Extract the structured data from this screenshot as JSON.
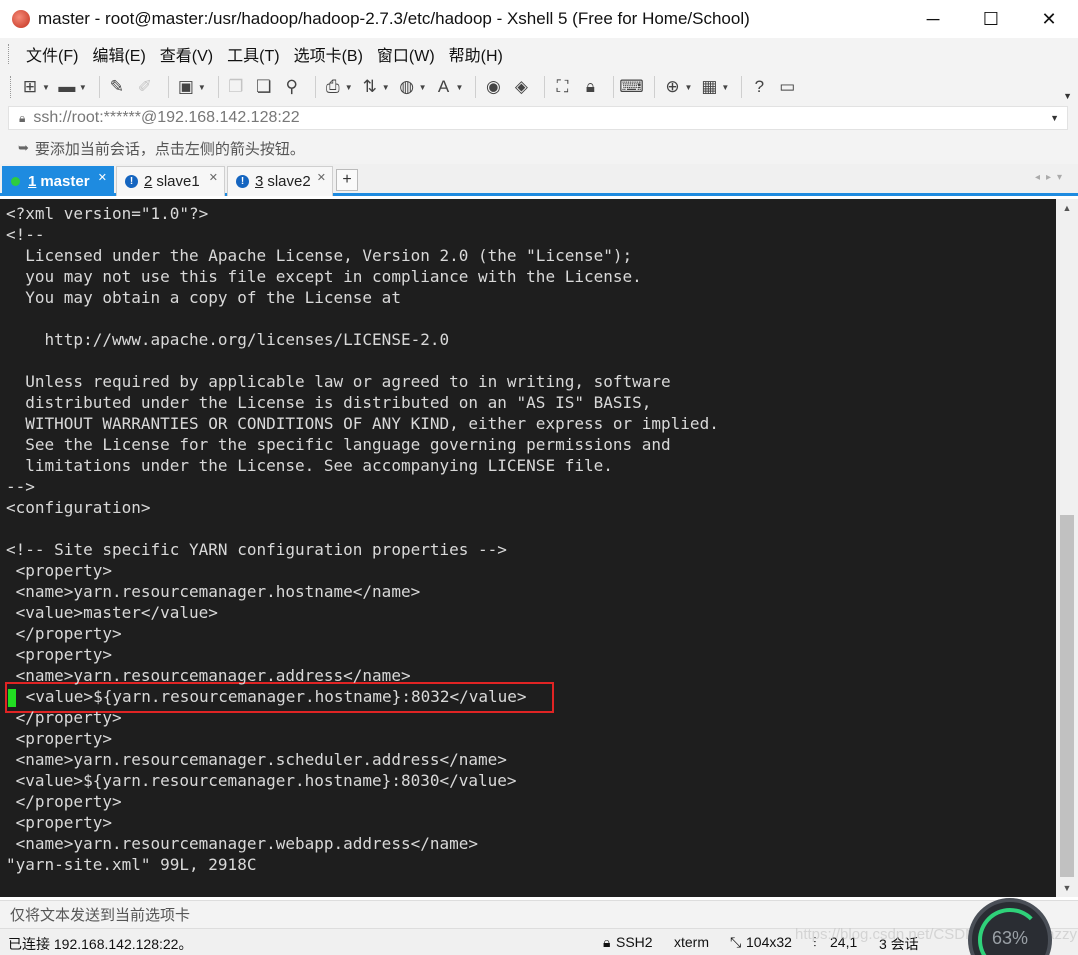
{
  "window": {
    "title": "master - root@master:/usr/hadoop/hadoop-2.7.3/etc/hadoop - Xshell 5 (Free for Home/School)",
    "minimize": "─",
    "maximize": "☐",
    "close": "✕"
  },
  "menu": {
    "items": [
      "文件(F)",
      "编辑(E)",
      "查看(V)",
      "工具(T)",
      "选项卡(B)",
      "窗口(W)",
      "帮助(H)"
    ]
  },
  "toolbar": {
    "icons": [
      "new-session-icon",
      "open-folder-icon",
      "reconnect-icon",
      "disconnect-icon",
      "properties-icon",
      "copy-icon",
      "paste-icon",
      "find-icon",
      "print-icon",
      "transfer-icon",
      "globe-icon",
      "font-icon",
      "xftp-icon",
      "xmanager-icon",
      "fullscreen-icon",
      "lock-icon",
      "keyboard-icon",
      "add-tab-icon",
      "layout-icon",
      "help-icon",
      "chat-icon"
    ]
  },
  "address": {
    "value": "ssh://root:******@192.168.142.128:22"
  },
  "hint": {
    "text": "要添加当前会话，点击左侧的箭头按钮。"
  },
  "tabs": [
    {
      "num": "1",
      "label": "master",
      "active": true
    },
    {
      "num": "2",
      "label": "slave1",
      "active": false
    },
    {
      "num": "3",
      "label": "slave2",
      "active": false
    }
  ],
  "add_tab": "+",
  "terminal": {
    "lines": [
      "<?xml version=\"1.0\"?>",
      "<!--",
      "  Licensed under the Apache License, Version 2.0 (the \"License\");",
      "  you may not use this file except in compliance with the License.",
      "  You may obtain a copy of the License at",
      "",
      "    http://www.apache.org/licenses/LICENSE-2.0",
      "",
      "  Unless required by applicable law or agreed to in writing, software",
      "  distributed under the License is distributed on an \"AS IS\" BASIS,",
      "  WITHOUT WARRANTIES OR CONDITIONS OF ANY KIND, either express or implied.",
      "  See the License for the specific language governing permissions and",
      "  limitations under the License. See accompanying LICENSE file.",
      "-->",
      "<configuration>",
      "",
      "<!-- Site specific YARN configuration properties -->",
      " <property>",
      " <name>yarn.resourcemanager.hostname</name>",
      " <value>master</value>",
      " </property>",
      " <property>",
      " <name>yarn.resourcemanager.address</name>",
      " <value>${yarn.resourcemanager.hostname}:8032</value>",
      " </property>",
      " <property>",
      " <name>yarn.resourcemanager.scheduler.address</name>",
      " <value>${yarn.resourcemanager.hostname}:8030</value>",
      " </property>",
      " <property>",
      " <name>yarn.resourcemanager.webapp.address</name>",
      "\"yarn-site.xml\" 99L, 2918C"
    ],
    "highlighted_line": 23
  },
  "send_bar": {
    "text": "仅将文本发送到当前选项卡"
  },
  "status": {
    "connection": "已连接 192.168.142.128:22。",
    "protocol": "SSH2",
    "term": "xterm",
    "size": "104x32",
    "cursor": "24,1",
    "sessions": "3 会话"
  },
  "overlay": {
    "gauge_value": "63%",
    "watermark": "https://blog.csdn.net/CSDN @Aria_Miazzy"
  }
}
